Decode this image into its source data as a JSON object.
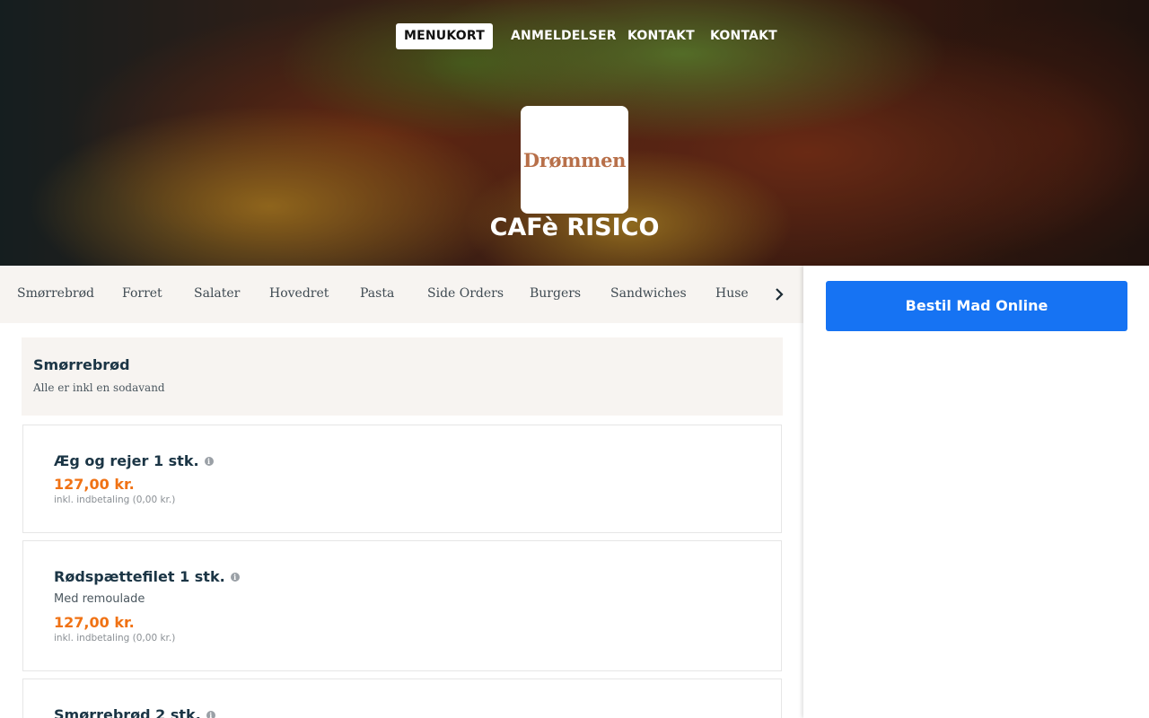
{
  "nav": {
    "items": [
      {
        "label": "MENUKORT",
        "active": true
      },
      {
        "label": "ANMELDELSER",
        "active": false
      },
      {
        "label": "KONTAKT",
        "active": false
      },
      {
        "label": "KONTAKT",
        "active": false
      }
    ]
  },
  "logo": {
    "text": "Drømmen"
  },
  "restaurant": {
    "name": "CAFè RISICO"
  },
  "categories": [
    "Smørrebrød",
    "Forret",
    "Salater",
    "Hovedret",
    "Pasta",
    "Side Orders",
    "Burgers",
    "Sandwiches",
    "Huse"
  ],
  "order_button": {
    "label": "Bestil Mad Online"
  },
  "section": {
    "title": "Smørrebrød",
    "subtitle": "Alle er inkl en sodavand",
    "items": [
      {
        "name": "Æg og rejer 1 stk.",
        "description": "",
        "price": "127,00 kr.",
        "fee": "inkl. indbetaling (0,00 kr.)"
      },
      {
        "name": "Rødspættefilet 1 stk.",
        "description": "Med remoulade",
        "price": "127,00 kr.",
        "fee": "inkl. indbetaling (0,00 kr.)"
      },
      {
        "name": "Smørrebrød 2 stk.",
        "description": "",
        "price": "",
        "fee": ""
      }
    ]
  },
  "icons": {
    "info": "info-icon",
    "arrow": "chevron-right-icon"
  },
  "colors": {
    "accent": "#1673f3",
    "price": "#f07214",
    "heading": "#1b3545",
    "category_bg": "#f7f4f1"
  }
}
